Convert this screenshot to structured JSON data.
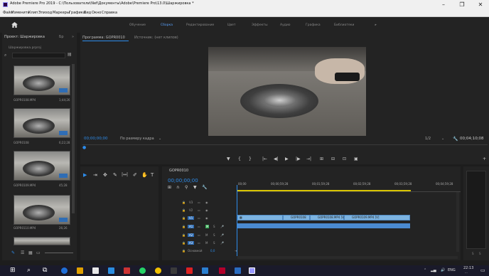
{
  "window": {
    "title": "Adobe Premiere Pro 2019 - C:\\Пользователи\\Nef\\Документы\\Adobe\\Premiere Pro\\13.0\\Шаржирoвка *",
    "controls": {
      "minimize": "–",
      "maximize": "❐",
      "close": "✕"
    }
  },
  "menu": [
    "Файл",
    "Изменить",
    "Клип",
    "Эпизод",
    "Маркеры",
    "Графика",
    "Вид",
    "Окно",
    "Справка"
  ],
  "workspaces": {
    "items": [
      "Обучение",
      "Сборка",
      "Редактирование",
      "Цвет",
      "Эффекты",
      "Аудио",
      "Графика",
      "Библиотеки"
    ],
    "active": "Сборка",
    "more": "»"
  },
  "project": {
    "tab": "Проект: Шаржирoвка",
    "tab2": "Бр",
    "subtitle": "Шаржирoвка.prproj",
    "items": [
      {
        "name": "GOPR0108.MP4",
        "duration": "1;44;26"
      },
      {
        "name": "GOPR0108",
        "duration": "6;22;28"
      },
      {
        "name": "GOPR0109.MP4",
        "duration": "45;28"
      },
      {
        "name": "GOPR0110.MP4",
        "duration": "26;26"
      }
    ]
  },
  "program": {
    "tab": "Программа: GOPR0010",
    "source_tab": "Источник: (нет клипов)",
    "timecode_current": "00;00;00;00",
    "fit_label": "По размеру кадра",
    "resolution": "1/2",
    "timecode_total": "00;04;10;08"
  },
  "playback_buttons": [
    "▼",
    "{",
    "}",
    "|←",
    "◀|",
    "▶",
    "|▶",
    "→|",
    "⊞",
    "⊟",
    "⊡",
    "▣"
  ],
  "tools": [
    "▶",
    "⇥",
    "✥",
    "✎",
    "|↔|",
    "✐",
    "✋",
    "T"
  ],
  "timeline": {
    "tab": "GOPR0010",
    "timecode": "00;00;00;00",
    "ruler": [
      "00;00",
      "00;00;59;28",
      "00;01;59;28",
      "00;02;59;28",
      "00;03;59;28",
      "00;04;59;28"
    ],
    "tracks": {
      "video": [
        "V3",
        "V2",
        "V1"
      ],
      "audio": [
        "A1",
        "A2",
        "A3"
      ],
      "master": "Основной",
      "master_value": "0,0"
    },
    "clips": [
      "GOPR0108",
      "GOPR0108.MP4 [V]",
      "GOPR0109.MP4 [V]"
    ]
  },
  "taskbar": {
    "lang": "ENG",
    "time": "22:13",
    "date": "..."
  },
  "colors": {
    "accent_blue": "#2d8ceb",
    "workspace_active": "#5aa3ff",
    "clip_video": "#7cb3e0",
    "clip_audio": "#4a8ad0",
    "ruler_yellow": "#d8c400"
  }
}
